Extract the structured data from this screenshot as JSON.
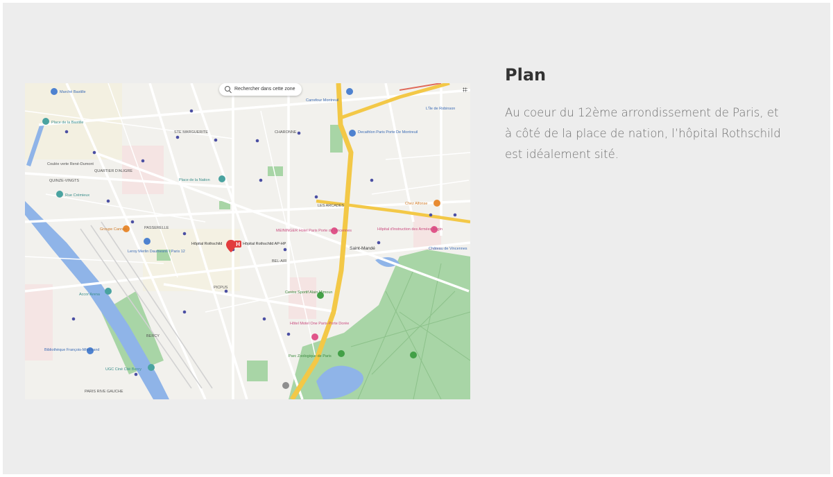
{
  "section": {
    "title": "Plan",
    "description_lines": [
      "Au coeur du 12ème arrondissement de Paris, et",
      "à côté de la place de nation, l’hôpital Rothschild",
      "est idéalement sité."
    ]
  },
  "map": {
    "search_label": "Rechercher dans cette zone",
    "labels": {
      "marche_bastille": "Marché Bastille",
      "place_bastille": "Place de la Bastille",
      "ste_marguerite": "STE MARGUERITE",
      "charonne": "CHARONNE",
      "carrefour": "Carrefour Montreuil",
      "ile_robinson": "L'Île de Robinson",
      "decathlon": "Decathlon Paris Porte De Montreuil",
      "coulee_verte": "Coulée verte René-Dumont",
      "quartier_aligre": "QUARTIER D'ALIGRE",
      "quinze_vingts": "QUINZE-VINGTS",
      "place_nation": "Place de la Nation",
      "rue_cremieux": "Rue Crémieux",
      "les_arcades": "LES ARCADES",
      "chez_alfonse": "Chez Alfonse",
      "passerelle": "PASSERELLE",
      "groupe": "Groupe Cannes",
      "leroy_merlin": "Leroy Merlin Daumesnil - Paris 12",
      "hopital_rothschild": "Hôpital Rothschild",
      "hopital_rothschild_aphp": "Hôpital Rothschild AP-HP",
      "meininger": "MEININGER Hotel Paris Porte de Vincennes",
      "hopital_begin": "Hôpital d'instruction des Armées Bégin",
      "saint_mande": "Saint-Mandé",
      "chateau_vincennes": "Château de Vincennes",
      "bel_air": "BEL-AIR",
      "picpus": "PICPUS",
      "centre_sportif": "Centre Sportif Alain Mimoun",
      "accor_arena": "Accor Arena",
      "hotel_motel": "Hôtel Motel One Paris-Porte Dorée",
      "bercy": "BERCY",
      "parc_zoologique": "Parc Zoologique de Paris",
      "bibliotheque": "Bibliothèque François-Mitterrand",
      "ugc": "UGC Ciné Cité Bercy",
      "paris_rive_gauche": "PARIS RIVE GAUCHE"
    }
  }
}
